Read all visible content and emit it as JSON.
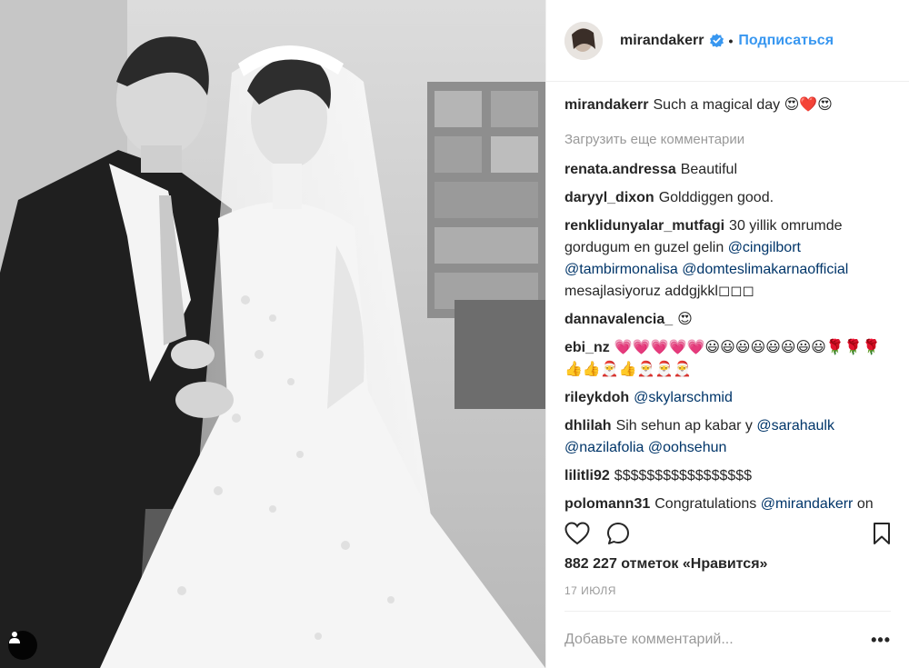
{
  "post": {
    "author": {
      "username": "mirandakerr",
      "verified_icon": "verified-badge-icon",
      "separator": "•",
      "follow_label": "Подписаться"
    },
    "caption": {
      "username": "mirandakerr",
      "text": "Such a magical day 😍❤️😍"
    },
    "load_more_label": "Загрузить еще комментарии",
    "comments": [
      {
        "username": "renata.andressa",
        "text": "Beautiful"
      },
      {
        "username": "daryyl_dixon",
        "text": "Golddiggen good."
      },
      {
        "username": "renklidunyalar_mutfagi",
        "text": "30 yillik omrumde gordugum en guzel gelin",
        "mentions": [
          "@cingilbort",
          "@tambirmonalisa",
          "@domteslimakarnaofficial"
        ],
        "tail": "mesajlasiyoruz addgjkkl◻◻◻"
      },
      {
        "username": "dannavalencia_",
        "text": "😍"
      },
      {
        "username": "ebi_nz",
        "text": "💗💗💗💗💗😃😃😃😃😃😃😃😃🌹🌹🌹👍👍🎅👍🎅🎅🎅"
      },
      {
        "username": "rileykdoh",
        "mention": "@skylarschmid"
      },
      {
        "username": "dhlilah",
        "text": "Sih sehun ap kabar y",
        "mentions": [
          "@sarahaulk",
          "@nazilafolia",
          "@oohsehun"
        ]
      },
      {
        "username": "lilitli92",
        "text": "$$$$$$$$$$$$$$$$$"
      },
      {
        "username": "polomann31",
        "text": "Congratulations",
        "mention": "@mirandakerr",
        "tail": "on you're marriage"
      }
    ],
    "actions": {
      "like_icon": "heart-outline-icon",
      "comment_icon": "comment-bubble-icon",
      "save_icon": "bookmark-outline-icon"
    },
    "likes_text": "882 227 отметок «Нравится»",
    "date": "17 июля",
    "add_comment_placeholder": "Добавьте комментарий...",
    "more_label": "•••"
  },
  "colors": {
    "link_blue": "#3897f0",
    "mention_blue": "#003569",
    "muted_gray": "#999999",
    "text": "#262626"
  }
}
